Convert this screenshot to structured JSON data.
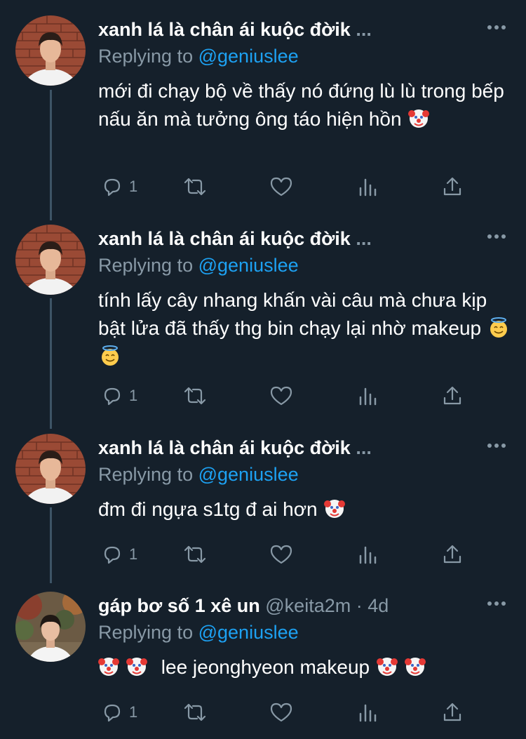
{
  "tweets": [
    {
      "name": "xanh lá là chân ái kuộc đờik",
      "truncated": "...",
      "handle": "",
      "dot": "",
      "time": "",
      "reply_prefix": "Replying to",
      "reply_handle": "@geniuslee",
      "text_parts": [
        "mới đi chạy bộ về thấy nó đứng lù lù trong bếp nấu ăn mà tưởng ông táo hiện hồn"
      ],
      "emojis": [
        "clown-face"
      ],
      "reply_count": "1",
      "avatar": "brick-wall-man"
    },
    {
      "name": "xanh lá là chân ái kuộc đờik",
      "truncated": "...",
      "handle": "",
      "dot": "",
      "time": "",
      "reply_prefix": "Replying to",
      "reply_handle": "@geniuslee",
      "text_parts": [
        "tính lấy cây nhang khấn vài câu mà chưa kịp bật lửa đã thấy thg bin chạy lại nhờ makeup"
      ],
      "emojis": [
        "smiling-face-with-halo",
        "smiling-face-with-halo"
      ],
      "reply_count": "1",
      "avatar": "brick-wall-man"
    },
    {
      "name": "xanh lá là chân ái kuộc đờik",
      "truncated": "...",
      "handle": "",
      "dot": "",
      "time": "",
      "reply_prefix": "Replying to",
      "reply_handle": "@geniuslee",
      "text_parts": [
        "đm đi ngựa s1tg đ ai hơn"
      ],
      "emojis": [
        "clown-face"
      ],
      "reply_count": "1",
      "avatar": "brick-wall-man"
    },
    {
      "name": "gáp bơ số 1 xê un",
      "truncated": "",
      "handle": "@keita2m",
      "dot": "·",
      "time": "4d",
      "reply_prefix": "Replying to",
      "reply_handle": "@geniuslee",
      "text_parts": [
        "lee jeonghyeon makeup"
      ],
      "emojis": [
        "clown-face",
        "clown-face",
        "clown-face",
        "clown-face"
      ],
      "reply_count": "1",
      "avatar": "garden-man"
    }
  ],
  "icons": {
    "reply": "reply-icon",
    "retweet": "retweet-icon",
    "like": "heart-icon",
    "analytics": "analytics-icon",
    "share": "share-icon",
    "more": "more-icon"
  },
  "colors": {
    "background": "#15202b",
    "secondary_text": "#8899a6",
    "link": "#1da1f2",
    "thread_line": "#3d5466"
  }
}
